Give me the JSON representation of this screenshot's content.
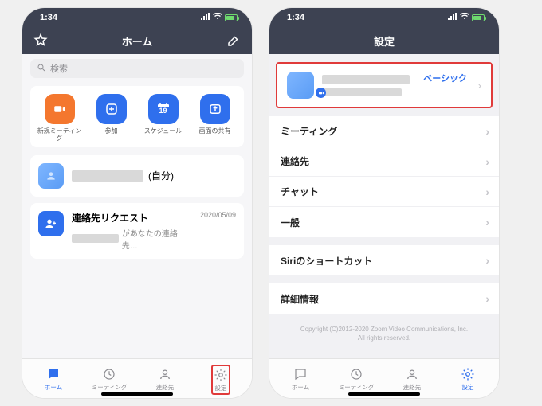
{
  "statusbar": {
    "time": "1:34"
  },
  "home": {
    "title": "ホーム",
    "search_placeholder": "検索",
    "actions": {
      "new_meeting": "新規ミーティング",
      "join": "参加",
      "schedule": "スケジュール",
      "share": "画面の共有",
      "schedule_date": "19"
    },
    "self_row": {
      "suffix": "(自分)"
    },
    "contact_req": {
      "title": "連絡先リクエスト",
      "date": "2020/05/09",
      "subtitle": "があなたの連絡先…"
    },
    "tabs": {
      "home": "ホーム",
      "meeting": "ミーティング",
      "contacts": "連絡先",
      "settings": "設定"
    }
  },
  "settings": {
    "title": "設定",
    "profile": {
      "plan": "ベーシック"
    },
    "items": {
      "meeting": "ミーティング",
      "contacts": "連絡先",
      "chat": "チャット",
      "general": "一般",
      "siri": "Siriのショートカット",
      "details": "詳細情報"
    },
    "copyright1": "Copyright (C)2012-2020 Zoom Video Communications, Inc.",
    "copyright2": "All rights reserved.",
    "tabs": {
      "home": "ホーム",
      "meeting": "ミーティング",
      "contacts": "連絡先",
      "settings": "設定"
    }
  }
}
